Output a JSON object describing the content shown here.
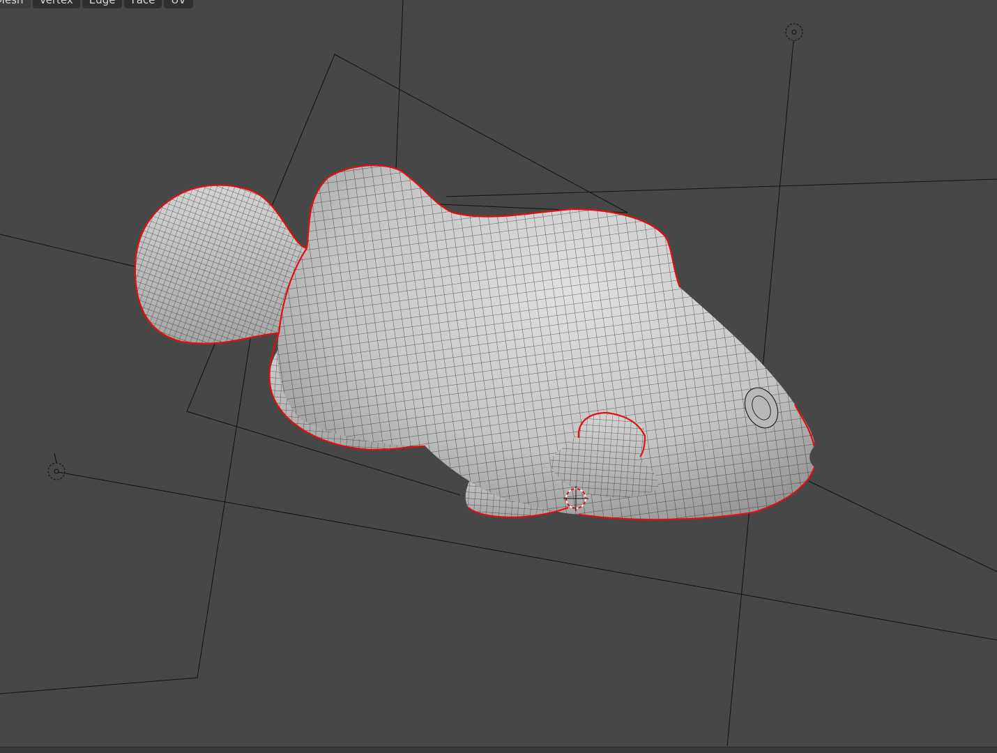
{
  "header": {
    "menus": [
      {
        "label": "Mesh"
      },
      {
        "label": "Vertex"
      },
      {
        "label": "Edge"
      },
      {
        "label": "Face"
      },
      {
        "label": "UV"
      }
    ]
  },
  "viewport": {
    "background": "#474747",
    "mesh_color": "#c8c8c8",
    "wire_color": "#111111",
    "seam_color": "#e01010"
  },
  "icons": [
    "light-icon",
    "light-icon",
    "3d-cursor-icon"
  ]
}
